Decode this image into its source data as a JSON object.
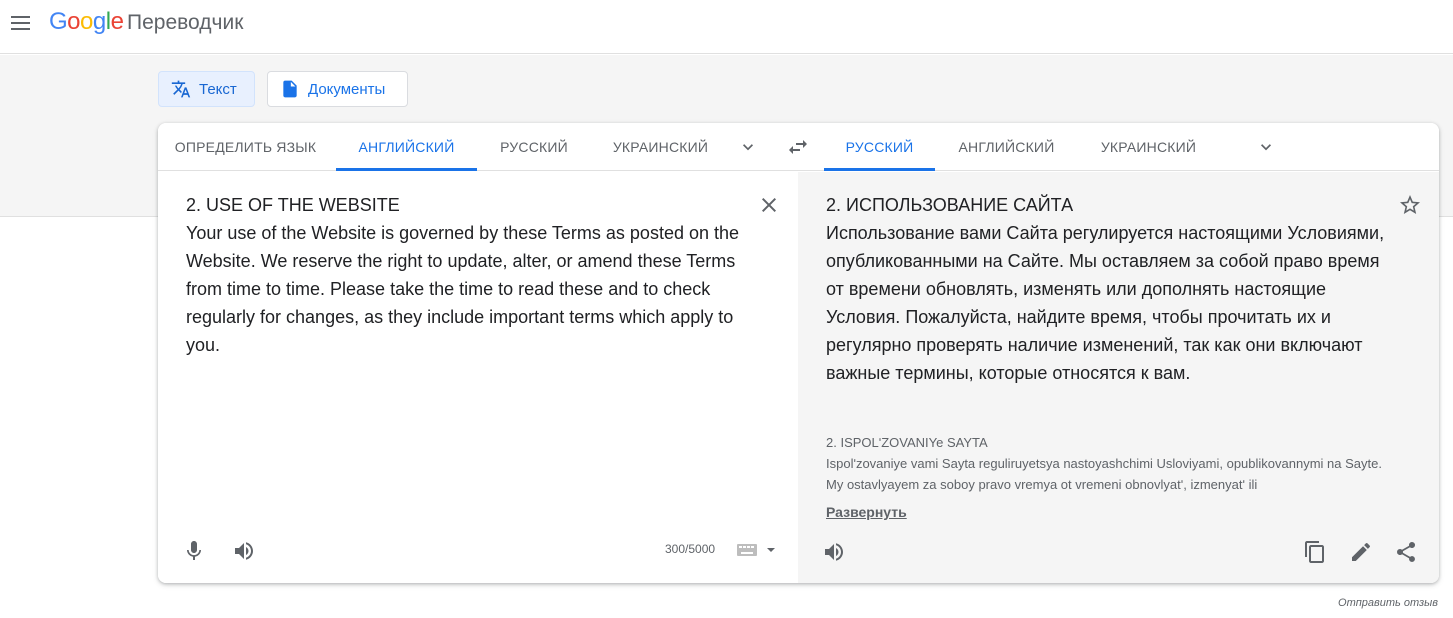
{
  "header": {
    "logo_text": "Google",
    "app_name": "Переводчик"
  },
  "modes": {
    "text_label": "Текст",
    "docs_label": "Документы"
  },
  "source_langs": {
    "detect": "ОПРЕДЕЛИТЬ ЯЗЫК",
    "tab1": "АНГЛИЙСКИЙ",
    "tab2": "РУССКИЙ",
    "tab3": "УКРАИНСКИЙ",
    "active": "АНГЛИЙСКИЙ"
  },
  "target_langs": {
    "tab1": "РУССКИЙ",
    "tab2": "АНГЛИЙСКИЙ",
    "tab3": "УКРАИНСКИЙ",
    "active": "РУССКИЙ"
  },
  "source": {
    "text": "2. USE OF THE WEBSITE\nYour use of the Website is governed by these Terms as posted on the Website. We reserve the right to update, alter, or amend these Terms from time to time. Please take the time to read these and to check regularly for changes, as they include important terms which apply to you.",
    "char_count": "300/5000"
  },
  "target": {
    "text": "2. ИСПОЛЬЗОВАНИЕ САЙТА\nИспользование вами Сайта регулируется настоящими Условиями, опубликованными на Сайте. Мы оставляем за собой право время от времени обновлять, изменять или дополнять настоящие Условия. Пожалуйста, найдите время, чтобы прочитать их и регулярно проверять наличие изменений, так как они включают важные термины, которые относятся к вам.",
    "transliteration": "2. ISPOLʹZOVANIYe SAYTA\nIspolʹzovaniye vami Sayta reguliruyetsya nastoyashchimi Usloviyami, opublikovannymi na Sayte. My ostavlyayem za soboy pravo vremya ot vremeni obnovlyatʹ, izmenyatʹ ili",
    "expand_label": "Развернуть"
  },
  "footer": {
    "feedback": "Отправить отзыв"
  },
  "colors": {
    "accent": "#1a73e8",
    "icon": "#5f6368",
    "panel_bg": "#f5f5f5"
  }
}
